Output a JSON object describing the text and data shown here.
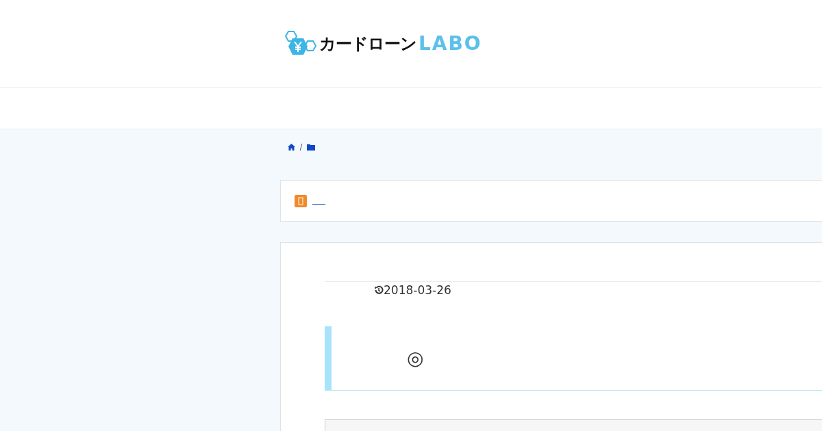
{
  "logo": {
    "name": "カードローン",
    "suffix": "LABO"
  },
  "article": {
    "updated_date": "2018-03-26",
    "box_text": "◎"
  }
}
